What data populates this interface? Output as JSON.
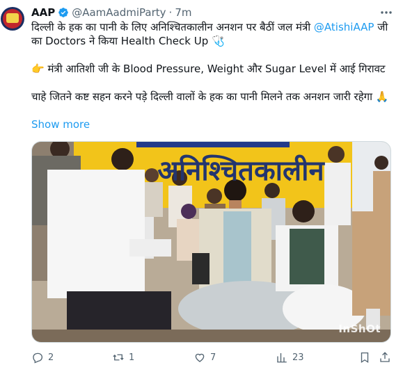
{
  "tweet": {
    "author_name": "AAP",
    "author_handle": "@AamAadmiParty",
    "separator": "·",
    "timestamp": "7m",
    "text_line1": "दिल्ली के हक का पानी के लिए अनिश्चितकालीन अनशन पर बैठीं जल मंत्री ",
    "mention": "@AtishiAAP",
    "text_line1_end": " जी का Doctors ने किया Health Check Up 🩺",
    "text_line2": "👉 मंत्री आतिशी जी के Blood Pressure, Weight और Sugar Level में आई गिरावट",
    "text_line3": "चाहे जितने कष्ट सहन करने पड़े दिल्ली वालों के हक का पानी मिलने तक अनशन जारी रहेगा 🙏",
    "show_more": "Show more",
    "media_banner_text": "अनिश्चितकालीन",
    "media_watermark": "InShOt"
  },
  "actions": {
    "replies": "2",
    "retweets": "1",
    "likes": "7",
    "views": "23"
  },
  "colors": {
    "link": "#1d9bf0",
    "secondary": "#536471",
    "verified": "#1d9bf0",
    "banner": "#f2c41a"
  },
  "icons": [
    "avatar",
    "verified-badge-icon",
    "more-options-icon",
    "reply-icon",
    "retweet-icon",
    "like-icon",
    "views-icon",
    "bookmark-icon",
    "share-icon"
  ]
}
